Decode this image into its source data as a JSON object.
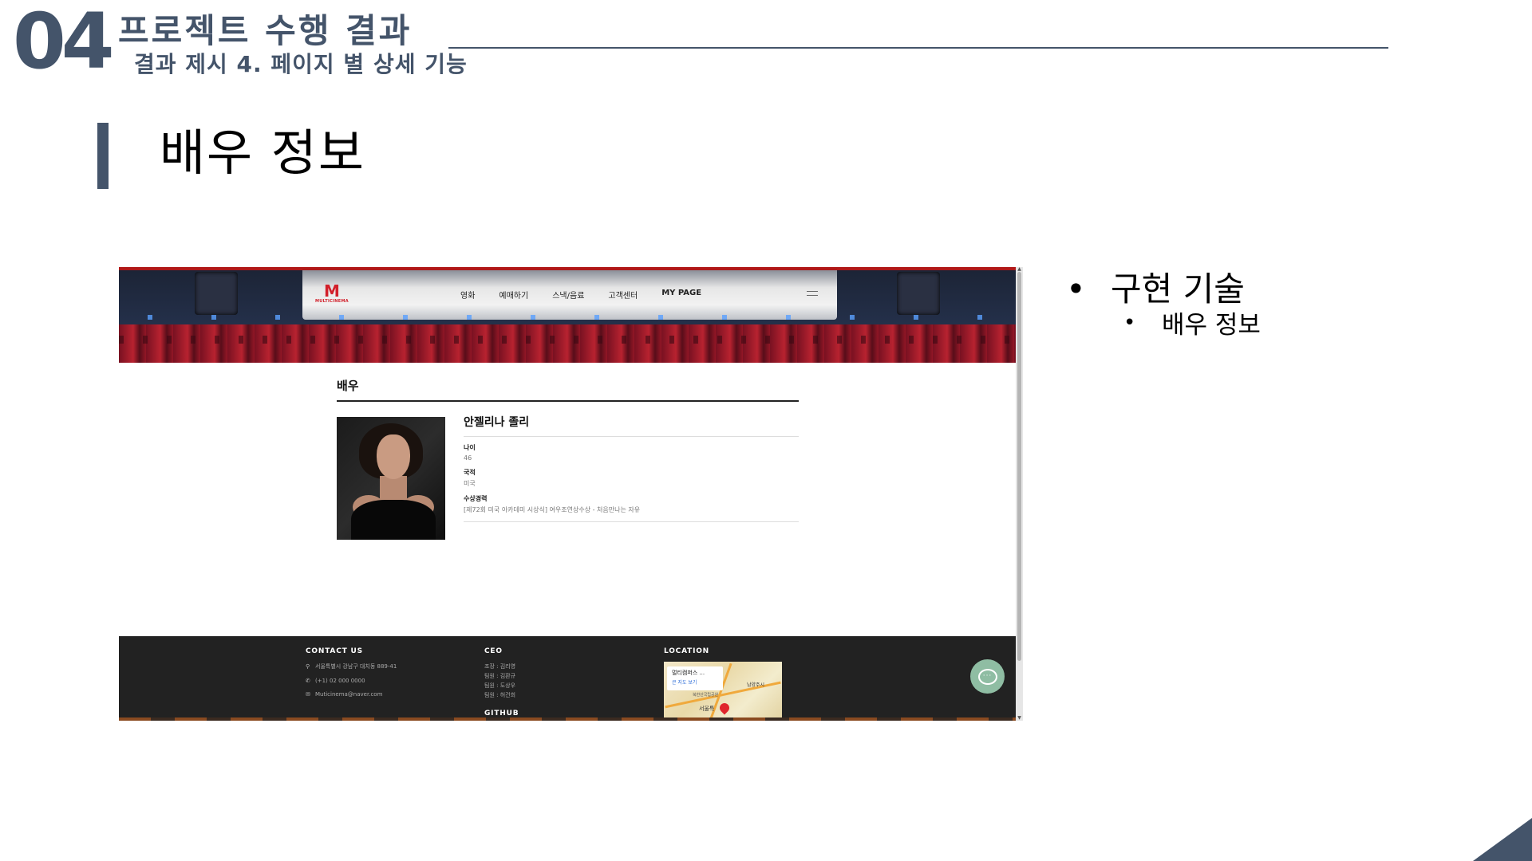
{
  "slide": {
    "section_number": "04",
    "section_title": "프로젝트 수행 결과",
    "section_subtitle": "결과 제시 4. 페이지 별 상세 기능",
    "title": "배우 정보",
    "bullets": [
      {
        "text": "구현 기술",
        "children": [
          {
            "text": "배우 정보"
          }
        ]
      }
    ],
    "accent_color": "#44546a"
  },
  "website": {
    "logo_text": "MULTICINEMA",
    "logo_mark": "M",
    "nav": [
      "영화",
      "예매하기",
      "스낵/음료",
      "고객센터",
      "MY PAGE"
    ],
    "section_heading": "배우",
    "actor": {
      "name": "안젤리나 졸리",
      "fields": [
        {
          "label": "나이",
          "value": "46"
        },
        {
          "label": "국적",
          "value": "미국"
        },
        {
          "label": "수상경력",
          "value": "[제72회 미국 아카데미 시상식] 여우조연상수상 - 처음만나는 자유"
        }
      ]
    },
    "footer": {
      "contact": {
        "heading": "CONTACT US",
        "address": "서울특별시 강남구 대치동 889-41",
        "phone": "(+1) 02 000 0000",
        "email": "Muticinema@naver.com"
      },
      "ceo": {
        "heading": "CEO",
        "members": [
          "조장 : 김리영",
          "팀원 : 김환규",
          "팀원 : 도상우",
          "팀원 : 허건희"
        ],
        "next_heading": "GITHUB"
      },
      "location": {
        "heading": "LOCATION",
        "map_title": "멀티캠퍼스 ...",
        "map_link": "큰 지도 보기",
        "map_city": "서울특",
        "map_label_2": "남양주시",
        "map_label_3": "북한산국립공원"
      }
    },
    "colors": {
      "brand": "#d21f2a",
      "footer_bg": "#222222",
      "chat_button": "#8fbda3"
    },
    "icons": {
      "address": "map-pin-icon",
      "phone": "phone-icon",
      "email": "envelope-icon",
      "chat": "chat-bubble-icon",
      "menu": "hamburger-menu-icon"
    }
  }
}
